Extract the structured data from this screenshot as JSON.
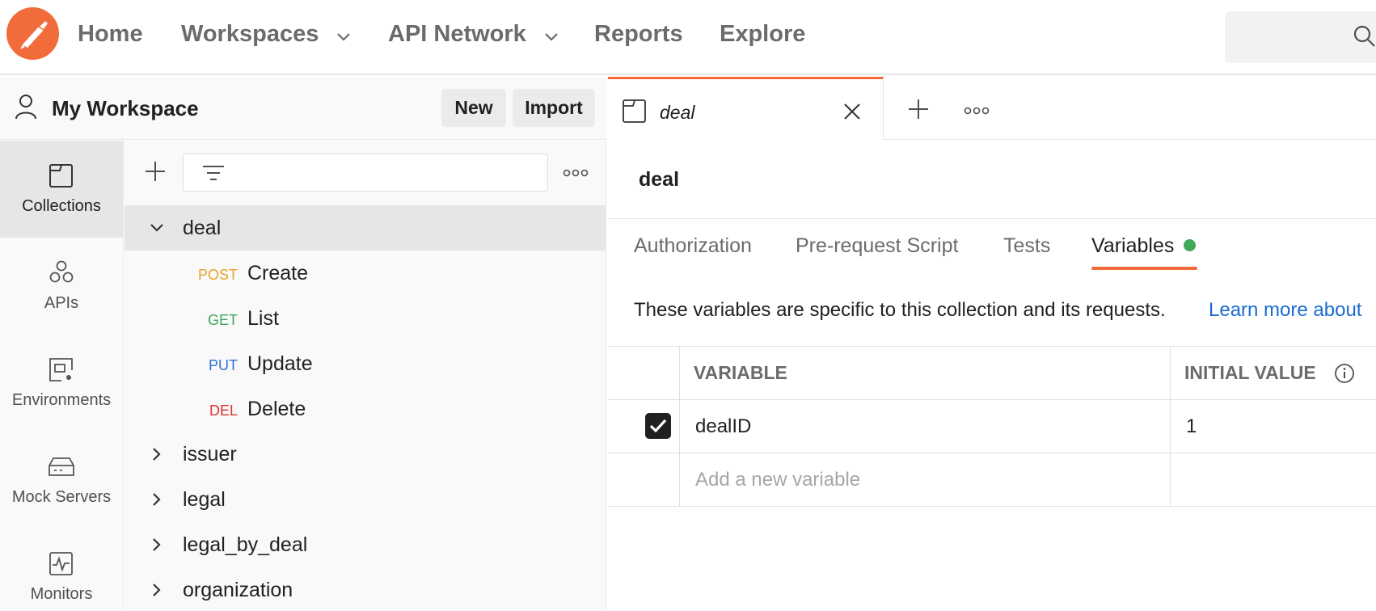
{
  "nav": {
    "home": "Home",
    "workspaces": "Workspaces",
    "api_network": "API Network",
    "reports": "Reports",
    "explore": "Explore"
  },
  "workspace": {
    "title": "My Workspace",
    "new_label": "New",
    "import_label": "Import"
  },
  "rail": [
    {
      "label": "Collections",
      "icon": "collection-icon",
      "active": true
    },
    {
      "label": "APIs",
      "icon": "apis-icon",
      "active": false
    },
    {
      "label": "Environments",
      "icon": "environment-icon",
      "active": false
    },
    {
      "label": "Mock Servers",
      "icon": "mock-server-icon",
      "active": false
    },
    {
      "label": "Monitors",
      "icon": "monitor-icon",
      "active": false
    }
  ],
  "tree": {
    "collections": [
      {
        "name": "deal",
        "expanded": true,
        "requests": [
          {
            "method": "POST",
            "name": "Create",
            "color": "#e5a52b"
          },
          {
            "method": "GET",
            "name": "List",
            "color": "#3fa85a"
          },
          {
            "method": "PUT",
            "name": "Update",
            "color": "#2f72d3"
          },
          {
            "method": "DEL",
            "name": "Delete",
            "color": "#d9342b"
          }
        ]
      },
      {
        "name": "issuer",
        "expanded": false
      },
      {
        "name": "legal",
        "expanded": false
      },
      {
        "name": "legal_by_deal",
        "expanded": false
      },
      {
        "name": "organization",
        "expanded": false
      }
    ]
  },
  "tab": {
    "title": "deal"
  },
  "collection": {
    "heading": "deal",
    "subtabs": [
      "Authorization",
      "Pre-request Script",
      "Tests",
      "Variables"
    ],
    "active_subtab": "Variables",
    "info_text": "These variables are specific to this collection and its requests.",
    "info_link": "Learn more about"
  },
  "variables_table": {
    "headers": [
      "VARIABLE",
      "INITIAL VALUE"
    ],
    "rows": [
      {
        "enabled": true,
        "variable": "dealID",
        "initial_value": "1"
      }
    ],
    "new_placeholder": "Add a new variable"
  },
  "colors": {
    "accent": "#f26b3a",
    "status_dot": "#3fa85a",
    "link": "#1a6bd1"
  }
}
